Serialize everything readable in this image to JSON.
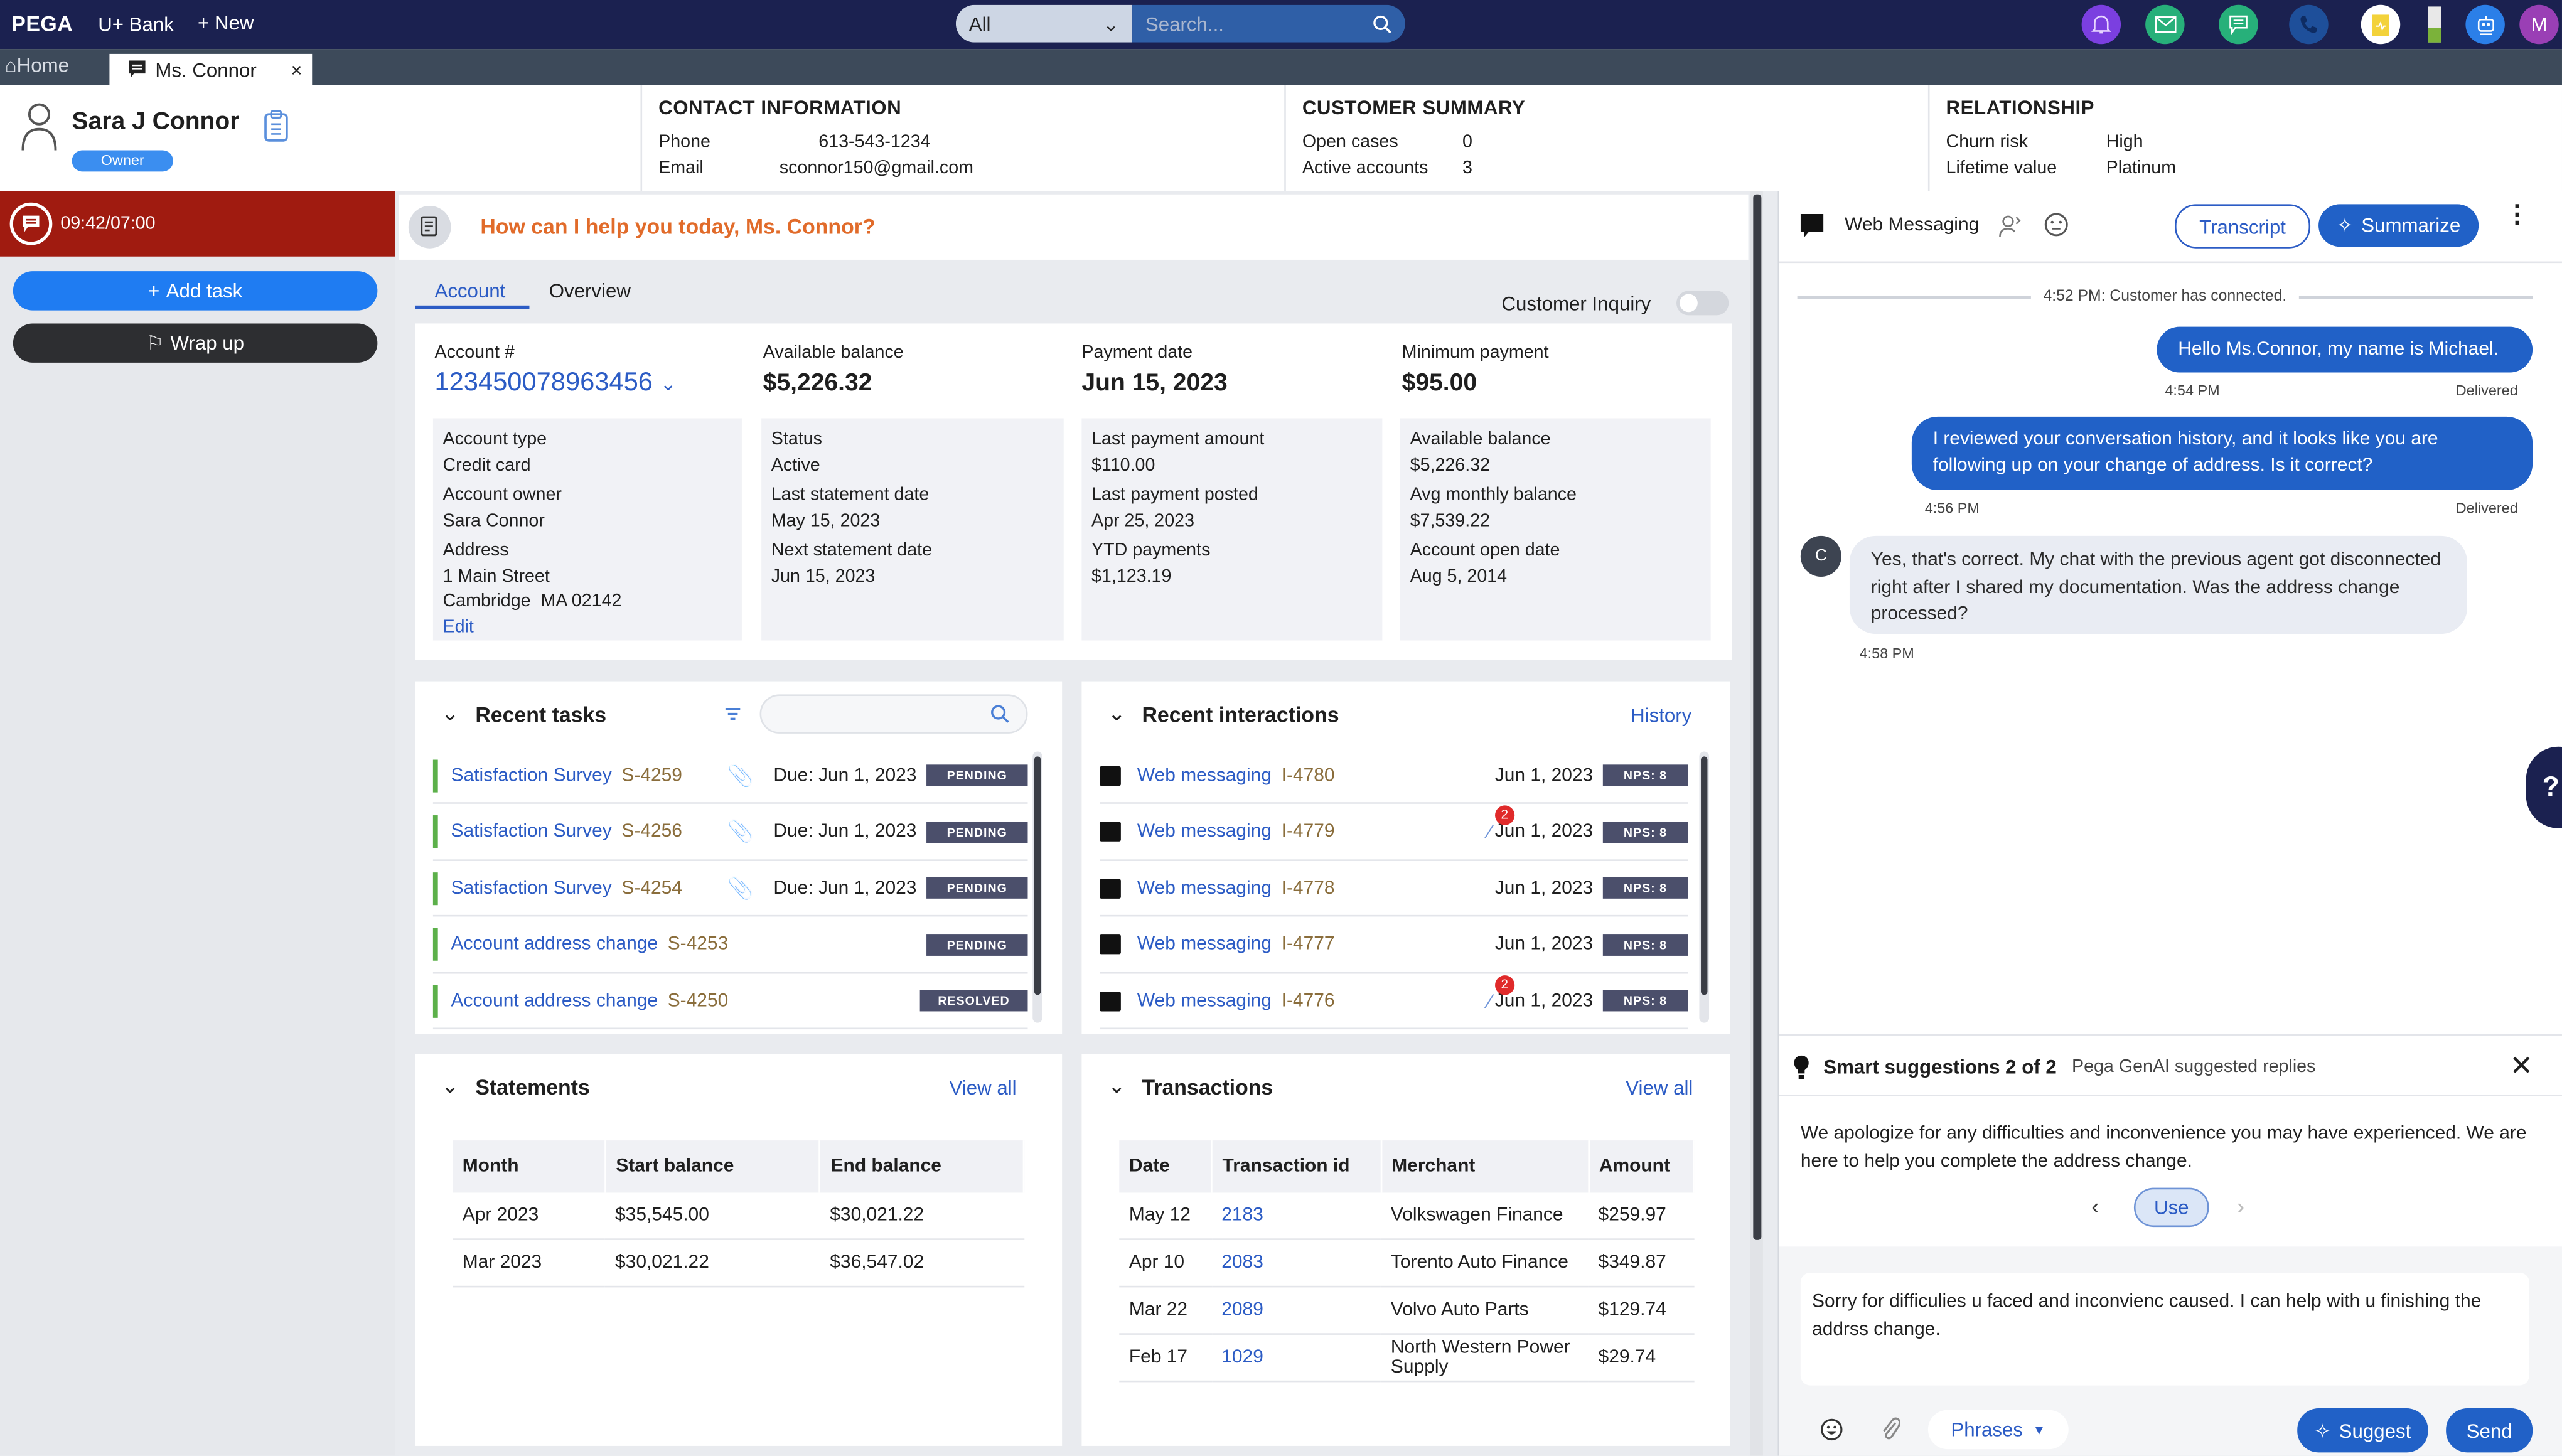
{
  "topbar": {
    "brand": "PEGA",
    "app_name": "U+ Bank",
    "new_label": "New",
    "search_scope": "All",
    "search_placeholder": "Search...",
    "avatar_initial": "M",
    "icons": [
      "bell-icon",
      "mail-icon",
      "chat-icon",
      "phone-icon",
      "clipboard-icon",
      "battery-indicator",
      "bot-icon",
      "user-avatar"
    ],
    "colors": {
      "bar": "#1b2150",
      "bell": "#7b3fe0",
      "mail": "#27b07a",
      "chat": "#27b07a",
      "phone": "#1e4f9a",
      "clipboard": "#f3d23a",
      "bot": "#2b7fe8",
      "avatar": "#9a3fb5"
    }
  },
  "tabs": [
    {
      "label": "Home",
      "active": false
    },
    {
      "label": "Ms. Connor",
      "active": true
    }
  ],
  "customer": {
    "name": "Sara J Connor",
    "role_badge": "Owner"
  },
  "header_sections": {
    "contact": {
      "title": "CONTACT INFORMATION",
      "rows": [
        {
          "k": "Phone",
          "v": "613-543-1234"
        },
        {
          "k": "Email",
          "v": "sconnor150@gmail.com"
        }
      ]
    },
    "summary": {
      "title": "CUSTOMER SUMMARY",
      "rows": [
        {
          "k": "Open cases",
          "v": "0"
        },
        {
          "k": "Active accounts",
          "v": "3"
        }
      ]
    },
    "relationship": {
      "title": "RELATIONSHIP",
      "rows": [
        {
          "k": "Churn risk",
          "v": "High"
        },
        {
          "k": "Lifetime value",
          "v": "Platinum"
        }
      ]
    }
  },
  "left_panel": {
    "timer": "09:42/07:00",
    "add_task": "Add task",
    "wrap_up": "Wrap up",
    "timer_color": "#a01b10"
  },
  "main": {
    "greeting": "How can I help you today, Ms. Connor?",
    "tabs": [
      {
        "label": "Account",
        "active": true
      },
      {
        "label": "Overview",
        "active": false
      }
    ],
    "customer_inquiry_label": "Customer Inquiry",
    "customer_inquiry_on": false,
    "kpis": [
      {
        "label": "Account #",
        "value": "123450078963456"
      },
      {
        "label": "Available balance",
        "value": "$5,226.32"
      },
      {
        "label": "Payment date",
        "value": "Jun 15, 2023"
      },
      {
        "label": "Minimum payment",
        "value": "$95.00"
      }
    ],
    "details": [
      [
        {
          "k": "Account type",
          "v": "Credit card"
        },
        {
          "k": "Account owner",
          "v": "Sara Connor"
        },
        {
          "k": "Address",
          "v": "1 Main Street",
          "v2": "Cambridge  MA 02142"
        }
      ],
      [
        {
          "k": "Status",
          "v": "Active"
        },
        {
          "k": "Last statement date",
          "v": "May 15, 2023"
        },
        {
          "k": "Next statement date",
          "v": "Jun 15, 2023"
        }
      ],
      [
        {
          "k": "Last payment amount",
          "v": "$110.00"
        },
        {
          "k": "Last payment posted",
          "v": "Apr 25, 2023"
        },
        {
          "k": "YTD payments",
          "v": "$1,123.19"
        }
      ],
      [
        {
          "k": "Available balance",
          "v": "$5,226.32"
        },
        {
          "k": "Avg monthly balance",
          "v": "$7,539.22"
        },
        {
          "k": "Account open date",
          "v": "Aug 5, 2014"
        }
      ]
    ],
    "edit_label": "Edit",
    "recent_tasks": {
      "title": "Recent tasks",
      "items": [
        {
          "name": "Satisfaction Survey",
          "id": "S-4259",
          "attachment": true,
          "due": "Due: Jun 1, 2023",
          "status": "PENDING"
        },
        {
          "name": "Satisfaction Survey",
          "id": "S-4256",
          "attachment": true,
          "due": "Due: Jun 1, 2023",
          "status": "PENDING"
        },
        {
          "name": "Satisfaction Survey",
          "id": "S-4254",
          "attachment": true,
          "due": "Due: Jun 1, 2023",
          "status": "PENDING"
        },
        {
          "name": "Account address change",
          "id": "S-4253",
          "attachment": false,
          "due": "",
          "status": "PENDING"
        },
        {
          "name": "Account address change",
          "id": "S-4250",
          "attachment": false,
          "due": "",
          "status": "RESOLVED"
        }
      ]
    },
    "recent_interactions": {
      "title": "Recent interactions",
      "history_link": "History",
      "items": [
        {
          "name": "Web messaging",
          "id": "I-4780",
          "attachments": 0,
          "date": "Jun 1, 2023",
          "nps": "NPS: 8"
        },
        {
          "name": "Web messaging",
          "id": "I-4779",
          "attachments": 2,
          "date": "Jun 1, 2023",
          "nps": "NPS: 8"
        },
        {
          "name": "Web messaging",
          "id": "I-4778",
          "attachments": 0,
          "date": "Jun 1, 2023",
          "nps": "NPS: 8"
        },
        {
          "name": "Web messaging",
          "id": "I-4777",
          "attachments": 0,
          "date": "Jun 1, 2023",
          "nps": "NPS: 8"
        },
        {
          "name": "Web messaging",
          "id": "I-4776",
          "attachments": 2,
          "date": "Jun 1, 2023",
          "nps": "NPS: 8"
        }
      ]
    },
    "statements": {
      "title": "Statements",
      "view_all": "View all",
      "columns": [
        "Month",
        "Start balance",
        "End balance"
      ],
      "rows": [
        [
          "Apr 2023",
          "$35,545.00",
          "$30,021.22"
        ],
        [
          "Mar 2023",
          "$30,021.22",
          "$36,547.02"
        ]
      ]
    },
    "transactions": {
      "title": "Transactions",
      "view_all": "View all",
      "columns": [
        "Date",
        "Transaction id",
        "Merchant",
        "Amount"
      ],
      "rows": [
        [
          "May 12",
          "2183",
          "Volkswagen Finance",
          "$259.97"
        ],
        [
          "Apr 10",
          "2083",
          "Torento Auto Finance",
          "$349.87"
        ],
        [
          "Mar 22",
          "2089",
          "Volvo Auto Parts",
          "$129.74"
        ],
        [
          "Feb 17",
          "1029",
          "North Western Power Supply",
          "$29.74"
        ]
      ]
    }
  },
  "chat": {
    "channel": "Web Messaging",
    "transcript_label": "Transcript",
    "summarize_label": "Summarize",
    "system_message": "4:52 PM: Customer has connected.",
    "messages": [
      {
        "from": "agent",
        "text": "Hello Ms.Connor, my name is Michael.",
        "time": "4:54 PM",
        "status": "Delivered"
      },
      {
        "from": "agent",
        "text": "I reviewed your conversation history, and it looks like you are following up on your change of address. Is it correct?",
        "time": "4:56 PM",
        "status": "Delivered"
      },
      {
        "from": "customer",
        "initial": "C",
        "text": "Yes, that's correct. My chat with the previous agent got disconnected right after I shared my documentation. Was the address change processed?",
        "time": "4:58 PM"
      }
    ],
    "help_label": "?",
    "suggestions": {
      "title": "Smart suggestions 2 of 2",
      "subtitle": "Pega GenAI suggested replies",
      "text": "We apologize for any difficulties and inconvenience you may have experienced. We are here to help you complete the address change.",
      "use_label": "Use"
    },
    "compose_text": "Sorry for difficulies u faced and inconvienc caused. I can help with u finishing the addrss change.",
    "phrases_label": "Phrases",
    "suggest_label": "Suggest",
    "send_label": "Send"
  }
}
